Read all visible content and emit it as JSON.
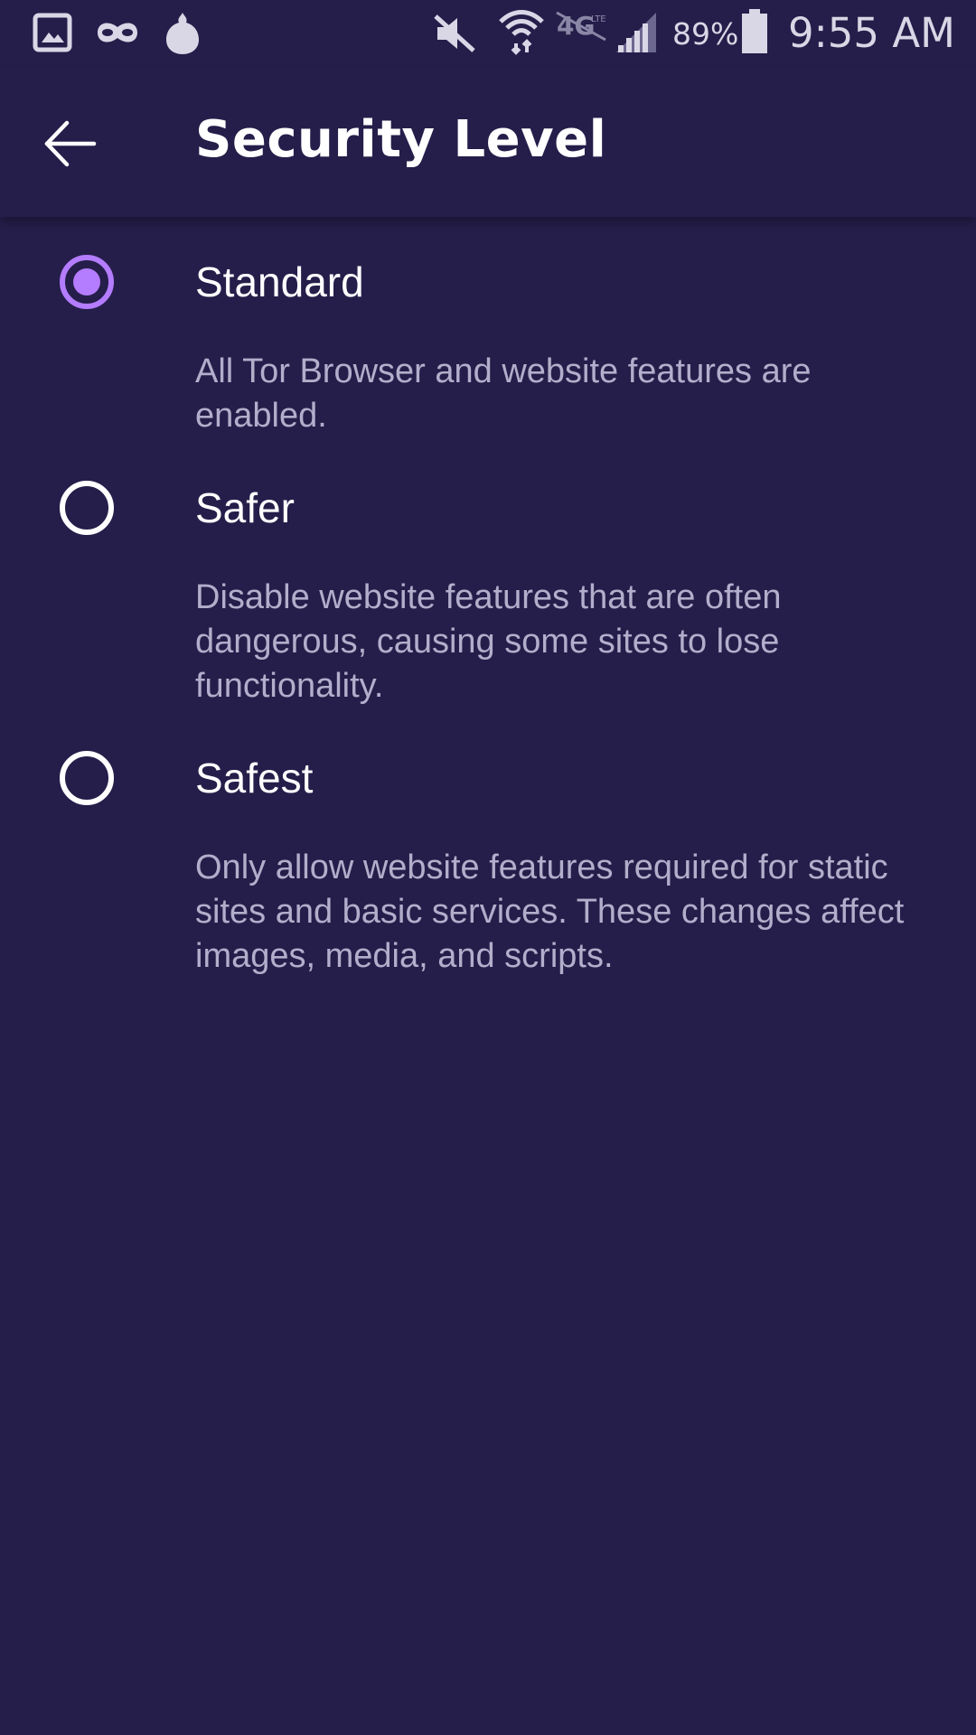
{
  "status_bar": {
    "icons": [
      "gallery-icon",
      "incognito-mask-icon",
      "tor-onion-icon",
      "mute-icon",
      "wifi-icon",
      "lte-icon",
      "cell-signal-icon",
      "battery-icon"
    ],
    "battery_percent": "89%",
    "time": "9:55 AM"
  },
  "app_bar": {
    "back_icon": "back-arrow-icon",
    "title": "Security Level"
  },
  "options": [
    {
      "label": "Standard",
      "description": "All Tor Browser and website features are enabled.",
      "selected": true
    },
    {
      "label": "Safer",
      "description": "Disable website features that are often dangerous, causing some sites to lose functionality.",
      "selected": false
    },
    {
      "label": "Safest",
      "description": "Only allow website features required for static sites and basic services. These changes affect images, media, and scripts.",
      "selected": false
    }
  ],
  "colors": {
    "background": "#251e4a",
    "accent": "#b47cff",
    "primary_text": "#ffffff",
    "secondary_text": "#b2aecb"
  }
}
